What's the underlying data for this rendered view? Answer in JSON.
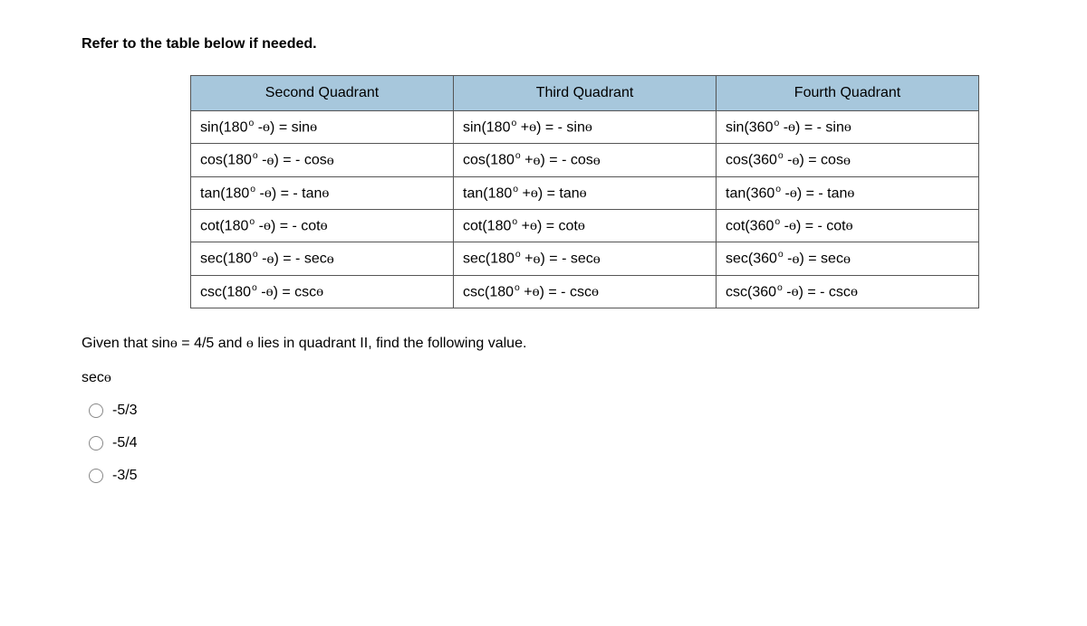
{
  "heading": "Refer to the table below if needed.",
  "table": {
    "headers": [
      "Second Quadrant",
      "Third Quadrant",
      "Fourth Quadrant"
    ],
    "rows": [
      {
        "c1": {
          "fn": "sin",
          "base": "180",
          "sign": "-",
          "rhs_neg": false,
          "rfn": "sin"
        },
        "c2": {
          "fn": "sin",
          "base": "180",
          "sign": "+",
          "rhs_neg": true,
          "rfn": "sin"
        },
        "c3": {
          "fn": "sin",
          "base": "360",
          "sign": "-",
          "rhs_neg": true,
          "rfn": "sin"
        }
      },
      {
        "c1": {
          "fn": "cos",
          "base": "180",
          "sign": "-",
          "rhs_neg": true,
          "rfn": "cos"
        },
        "c2": {
          "fn": "cos",
          "base": "180",
          "sign": "+",
          "rhs_neg": true,
          "rfn": "cos"
        },
        "c3": {
          "fn": "cos",
          "base": "360",
          "sign": "-",
          "rhs_neg": false,
          "rfn": "cos"
        }
      },
      {
        "c1": {
          "fn": "tan",
          "base": "180",
          "sign": "-",
          "rhs_neg": true,
          "rfn": "tan"
        },
        "c2": {
          "fn": "tan",
          "base": "180",
          "sign": "+",
          "rhs_neg": false,
          "rfn": "tan"
        },
        "c3": {
          "fn": "tan",
          "base": "360",
          "sign": "-",
          "rhs_neg": true,
          "rfn": "tan"
        }
      },
      {
        "c1": {
          "fn": "cot",
          "base": "180",
          "sign": "-",
          "rhs_neg": true,
          "rfn": "cot"
        },
        "c2": {
          "fn": "cot",
          "base": "180",
          "sign": "+",
          "rhs_neg": false,
          "rfn": "cot"
        },
        "c3": {
          "fn": "cot",
          "base": "360",
          "sign": "-",
          "rhs_neg": true,
          "rfn": "cot"
        }
      },
      {
        "c1": {
          "fn": "sec",
          "base": "180",
          "sign": "-",
          "rhs_neg": true,
          "rfn": "sec"
        },
        "c2": {
          "fn": "sec",
          "base": "180",
          "sign": "+",
          "rhs_neg": true,
          "rfn": "sec"
        },
        "c3": {
          "fn": "sec",
          "base": "360",
          "sign": "-",
          "rhs_neg": false,
          "rfn": "sec"
        }
      },
      {
        "c1": {
          "fn": "csc",
          "base": "180",
          "sign": "-",
          "rhs_neg": false,
          "rfn": "csc"
        },
        "c2": {
          "fn": "csc",
          "base": "180",
          "sign": "+",
          "rhs_neg": true,
          "rfn": "csc"
        },
        "c3": {
          "fn": "csc",
          "base": "360",
          "sign": "-",
          "rhs_neg": true,
          "rfn": "csc"
        }
      }
    ]
  },
  "question": {
    "pre": "Given that sin",
    "mid": " = 4/5 and ",
    "post": " lies in quadrant II, find the following value."
  },
  "find": "sec",
  "options": [
    "-5/3",
    "-5/4",
    "-3/5"
  ]
}
